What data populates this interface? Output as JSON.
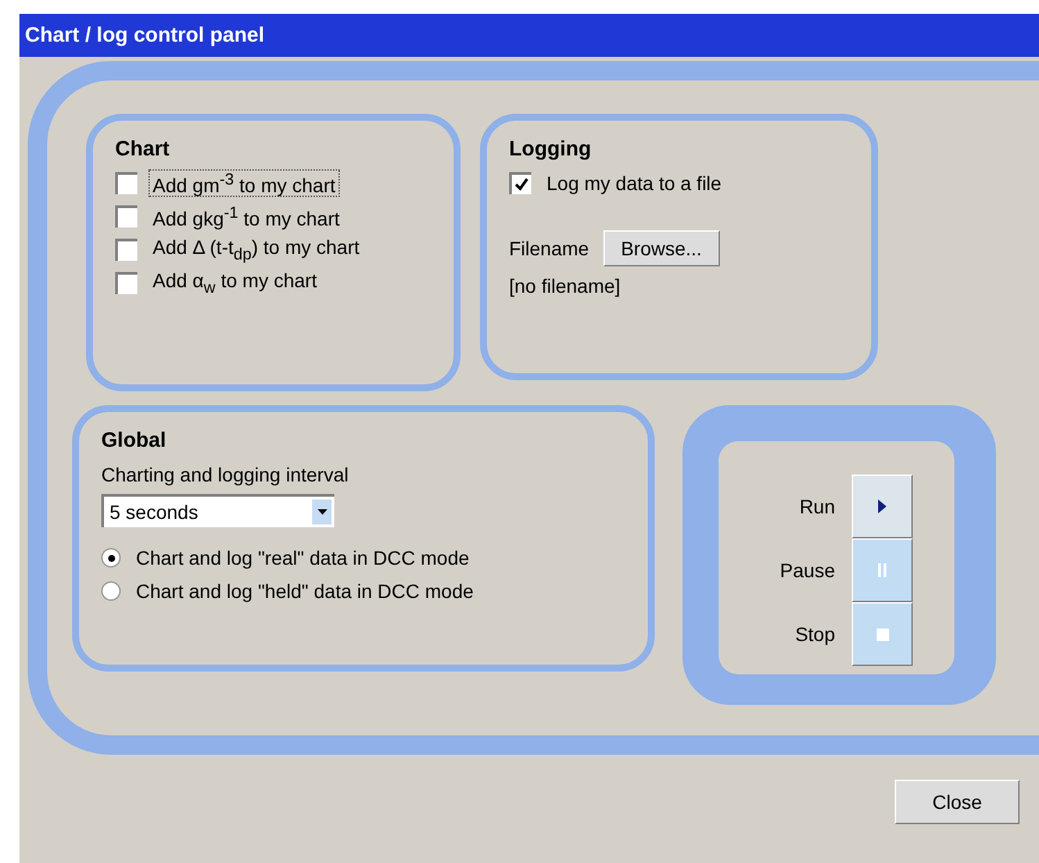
{
  "window": {
    "title": "Chart / log control panel"
  },
  "chart": {
    "title": "Chart",
    "options": [
      {
        "label": "Add gm$^{-3}$ to my chart",
        "checked": false,
        "focused": true
      },
      {
        "label": "Add gkg$^{-1}$ to my chart",
        "checked": false,
        "focused": false
      },
      {
        "label": "Add Δ (t-t$_{dp}$) to my chart",
        "checked": false,
        "focused": false
      },
      {
        "label": "Add α$_{w}$ to my chart",
        "checked": false,
        "focused": false
      }
    ]
  },
  "logging": {
    "title": "Logging",
    "option": {
      "label": "Log my data to a file",
      "checked": true
    },
    "filename_label": "Filename",
    "browse_button": "Browse...",
    "filename": "[no filename]"
  },
  "global": {
    "title": "Global",
    "interval_label": "Charting and logging interval",
    "interval": "5 seconds",
    "modes": [
      {
        "label": "Chart and log \"real\" data in DCC mode",
        "selected": true
      },
      {
        "label": "Chart and log \"held\" data in DCC mode",
        "selected": false
      }
    ]
  },
  "controls": [
    {
      "kind": "run",
      "label": "Run",
      "disabled": false
    },
    {
      "kind": "pause",
      "label": "Pause",
      "disabled": true
    },
    {
      "kind": "stop",
      "label": "Stop",
      "disabled": true
    }
  ],
  "close_button": "Close"
}
